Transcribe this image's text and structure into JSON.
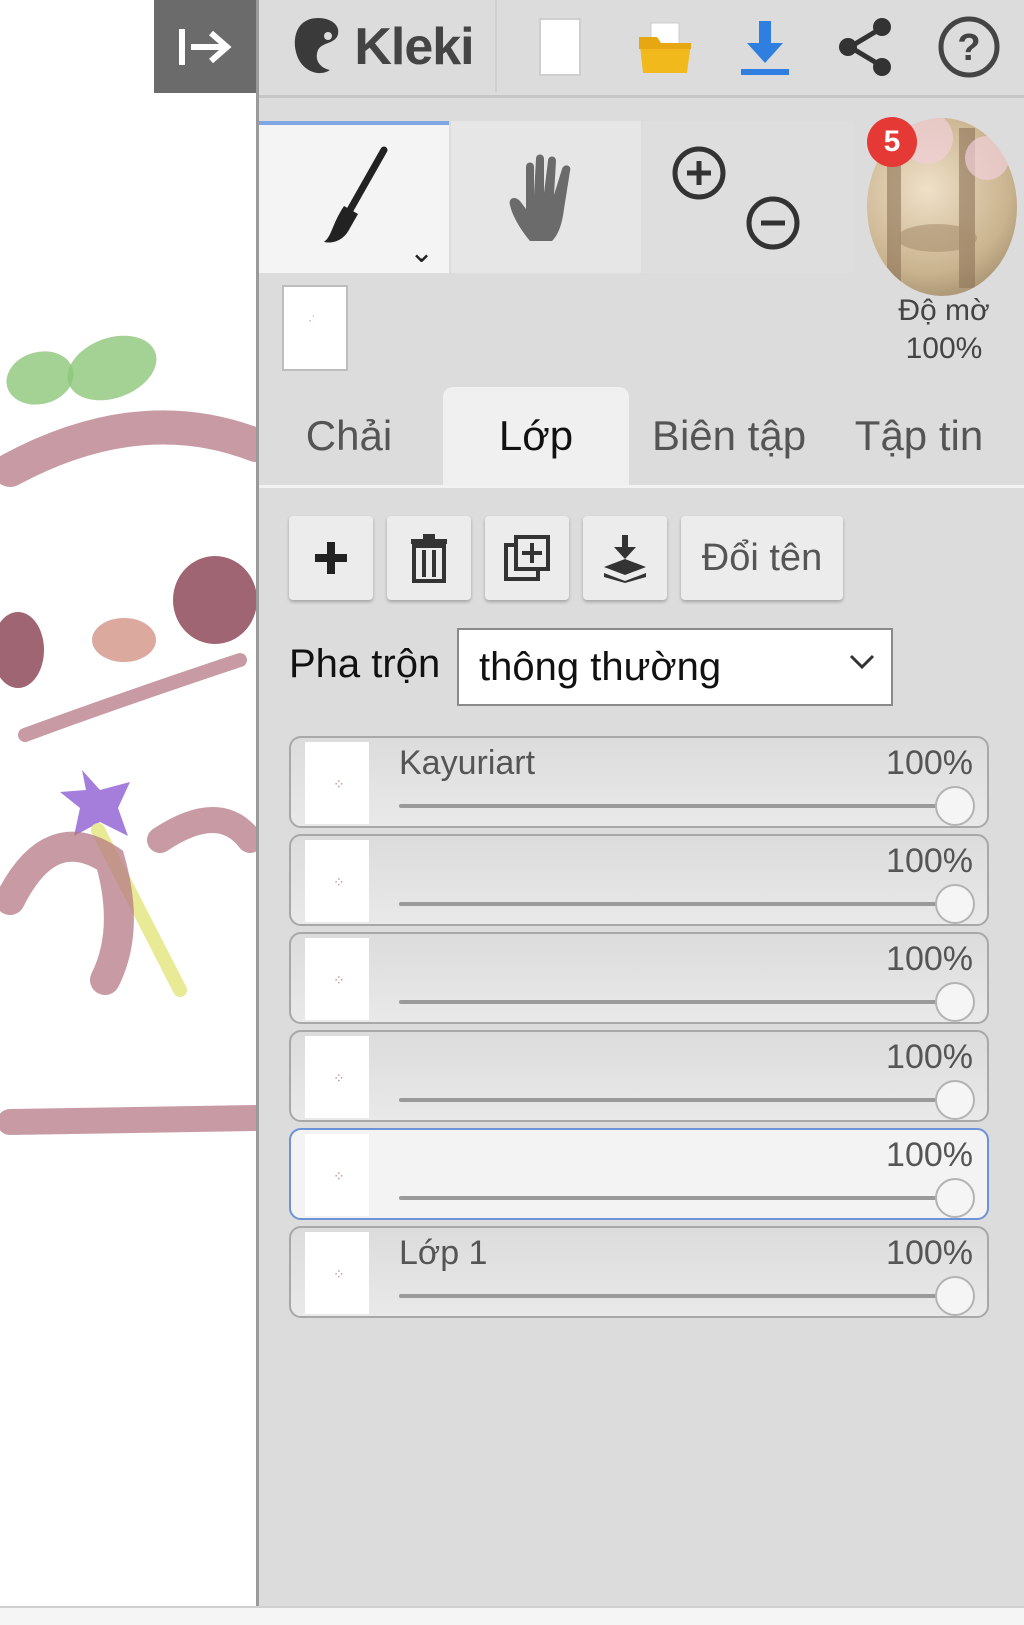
{
  "app": {
    "logo_text": "Kleki"
  },
  "toolbar": {
    "collapse_icon": "collapse-right-icon",
    "new_icon": "new-file-icon",
    "open_icon": "folder-icon",
    "download_icon": "download-icon",
    "share_icon": "share-icon",
    "help_icon": "help-icon"
  },
  "tools": {
    "brush_icon": "brush-icon",
    "hand_icon": "hand-icon",
    "zoom_in_icon": "zoom-in-icon",
    "zoom_out_icon": "zoom-out-icon"
  },
  "notification": {
    "count": "5"
  },
  "opacity": {
    "label": "Độ mờ",
    "value": "100%"
  },
  "tabs": [
    {
      "label": "Chải",
      "active": false
    },
    {
      "label": "Lớp",
      "active": true
    },
    {
      "label": "Biên tập",
      "active": false
    },
    {
      "label": "Tập tin",
      "active": false
    }
  ],
  "layer_actions": {
    "add_icon": "plus-icon",
    "delete_icon": "trash-icon",
    "duplicate_icon": "duplicate-icon",
    "merge_icon": "merge-down-icon",
    "rename_label": "Đổi tên"
  },
  "blend": {
    "label": "Pha trộn",
    "value": "thông thường"
  },
  "layers": [
    {
      "name": "Kayuriart",
      "opacity": "100%",
      "selected": false
    },
    {
      "name": "",
      "opacity": "100%",
      "selected": false
    },
    {
      "name": "",
      "opacity": "100%",
      "selected": false
    },
    {
      "name": "",
      "opacity": "100%",
      "selected": false
    },
    {
      "name": "",
      "opacity": "100%",
      "selected": true
    },
    {
      "name": "Lớp 1",
      "opacity": "100%",
      "selected": false
    }
  ],
  "colors": {
    "accent": "#2f7fe0",
    "badge": "#e53935",
    "panel": "#dcdcdc"
  }
}
